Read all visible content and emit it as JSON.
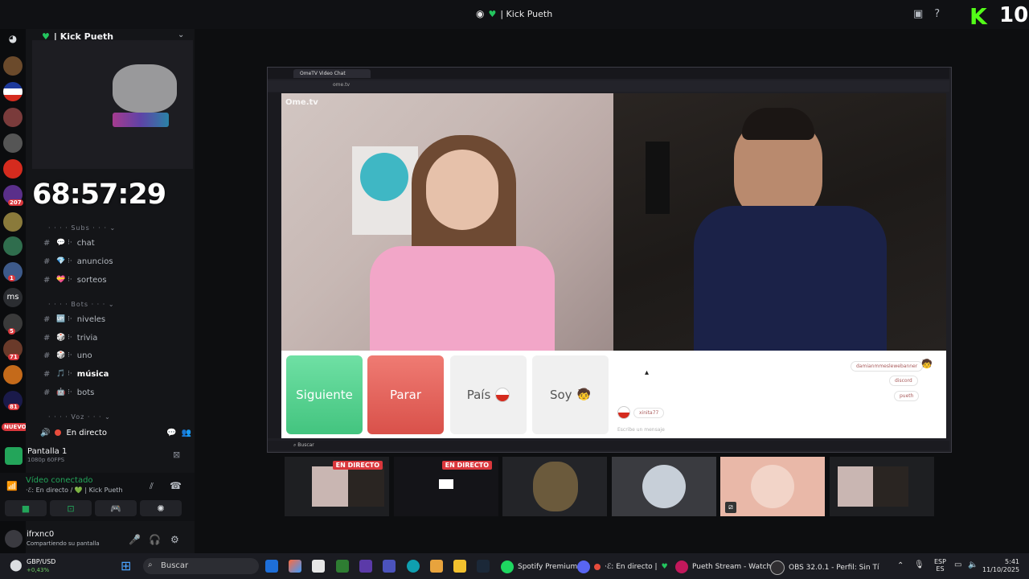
{
  "titlebar": {
    "title": "| Kick Pueth"
  },
  "kick": {
    "count": "10"
  },
  "server": {
    "name": "| Kick Pueth"
  },
  "stream_timer": "68:57:29",
  "categories": {
    "subs": "Subs",
    "bots": "Bots",
    "voz": "Voz"
  },
  "channels": [
    {
      "name": "chat",
      "prefix": "💬 ⁝·",
      "icon": "speech-bubble"
    },
    {
      "name": "anuncios",
      "prefix": "💎 ⁝·",
      "icon": "diamond"
    },
    {
      "name": "sorteos",
      "prefix": "💝 ⁝·",
      "icon": "gift-heart"
    },
    {
      "name": "niveles",
      "prefix": "🆙 ⁝·",
      "icon": "up-arrow"
    },
    {
      "name": "trivia",
      "prefix": "🎲 ⁝·",
      "icon": "dice"
    },
    {
      "name": "uno",
      "prefix": "🎲 ⁝·",
      "icon": "dice"
    },
    {
      "name": "música",
      "prefix": "🎵 ⁝·",
      "icon": "music-note"
    },
    {
      "name": "bots",
      "prefix": "🤖 ⁝·",
      "icon": "robot"
    }
  ],
  "server_badges": [
    "207",
    "1",
    "5",
    "71",
    "81"
  ],
  "server_initials": "ms",
  "nuevo": "NUEVO",
  "voice_live": "En directo",
  "screen_share": {
    "title": "Pantalla 1",
    "sub": "1080p 60FPS"
  },
  "voice": {
    "connected": "Vídeo conectado",
    "channel": "·ℰ: En directo / 💚 | Kick Pueth"
  },
  "user": {
    "name": "ifrxnc0",
    "status": "Compartiendo su pantalla"
  },
  "browser": {
    "tab": "OmeTV Video Chat",
    "url": "ome.tv",
    "taskbar_search": "Buscar"
  },
  "ometv": {
    "logo": "Ome.tv",
    "btn_next": "Siguiente",
    "btn_stop": "Parar",
    "btn_country": "País",
    "btn_me": "Soy",
    "chat_messages": [
      "damianmmeslewebanner",
      "discord",
      "pueth"
    ],
    "chat_user": "xinita77",
    "chat_placeholder": "Escribe un mensaje"
  },
  "thumbnails": [
    {
      "badge": "EN DIRECTO"
    },
    {
      "badge": "EN DIRECTO"
    },
    {
      "badge": ""
    },
    {
      "badge": ""
    },
    {
      "badge": ""
    },
    {
      "badge": ""
    }
  ],
  "taskbar": {
    "forex_pair": "GBP/USD",
    "forex_change": "+0,43%",
    "search": "Buscar",
    "spotify": "Spotify Premium",
    "discord": "·ℰ: En directo |",
    "browser": "Pueth Stream - Watch L",
    "obs": "OBS 32.0.1 - Perfil: Sin Tí",
    "lang_top": "ESP",
    "lang_bottom": "ES",
    "time": "5:41",
    "date": "11/10/2025"
  },
  "colors": {
    "accent_green": "#53fc18",
    "live_red": "#da373c",
    "next_green": "#43c47f",
    "stop_red": "#d9514a"
  }
}
